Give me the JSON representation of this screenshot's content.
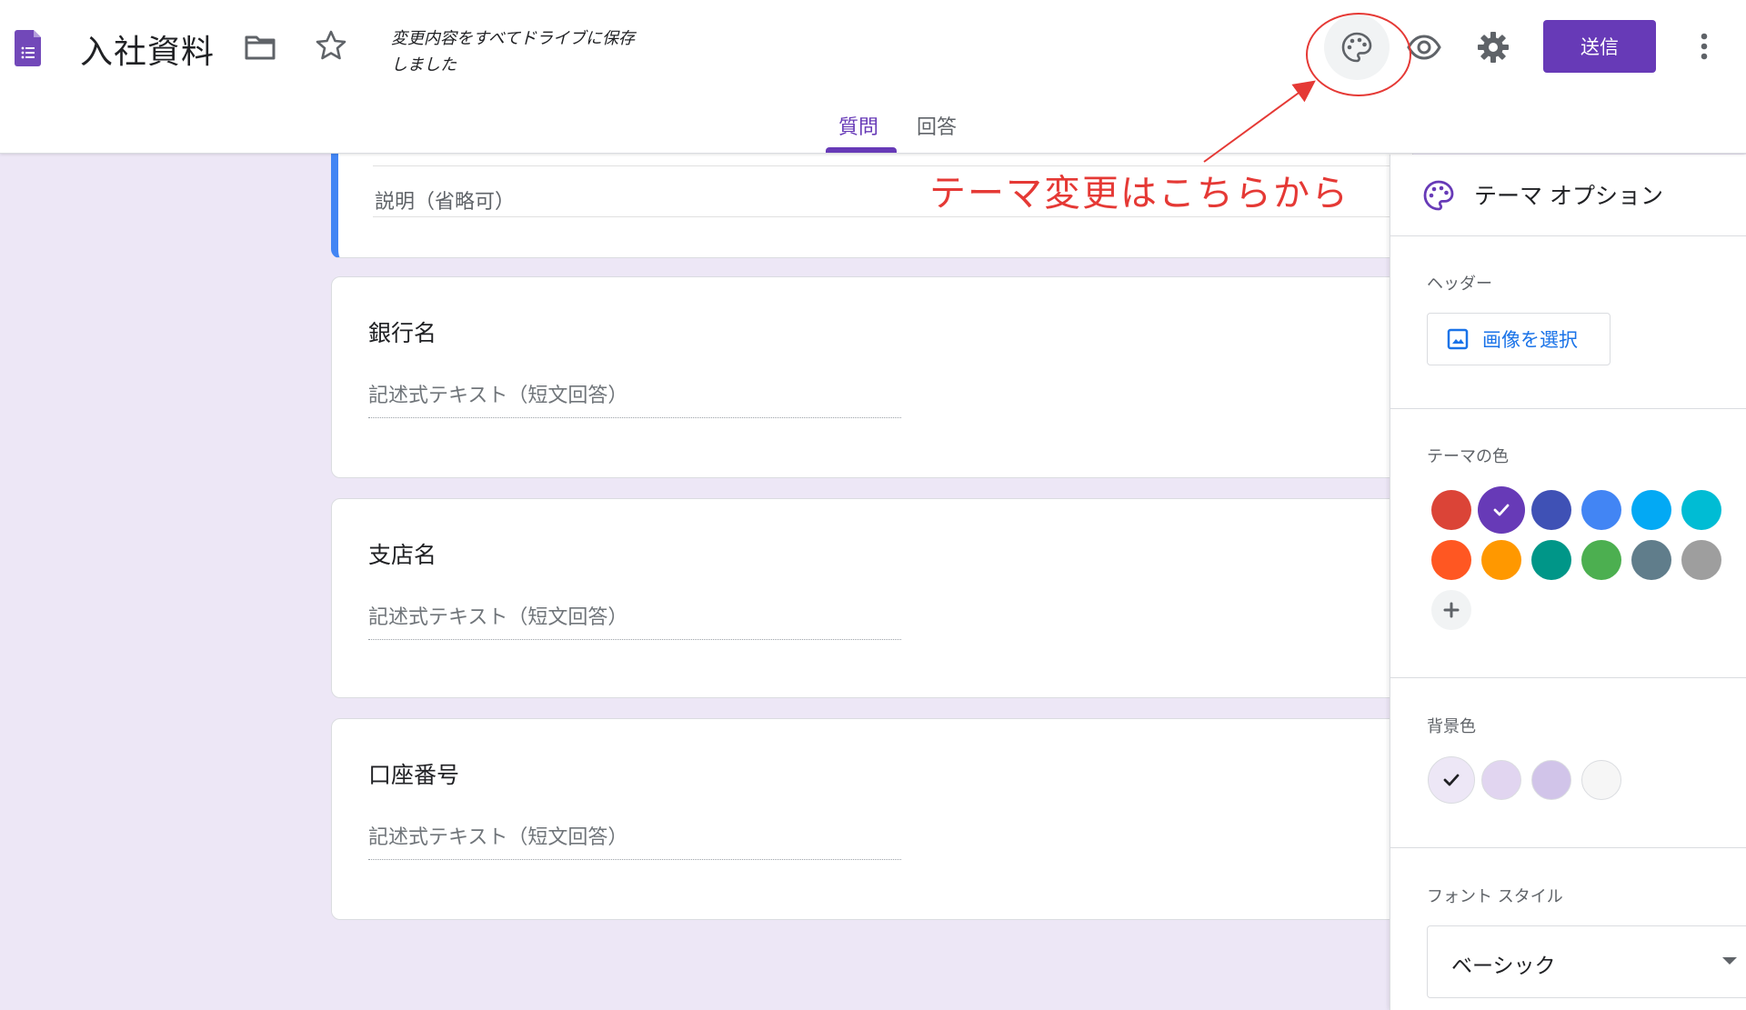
{
  "header": {
    "title": "入社資料",
    "save_status": "変更内容をすべてドライブに保存しました",
    "send_label": "送信",
    "tabs": [
      {
        "label": "質問",
        "active": true
      },
      {
        "label": "回答",
        "active": false
      }
    ],
    "icons": [
      "forms-logo-icon",
      "folder-icon",
      "star-icon",
      "palette-icon",
      "eye-icon",
      "gear-icon",
      "more-vert-icon"
    ],
    "accent_color": "#673ab7"
  },
  "form": {
    "description_placeholder": "説明（省略可）",
    "questions": [
      {
        "title": "銀行名",
        "answer_placeholder": "記述式テキスト（短文回答）"
      },
      {
        "title": "支店名",
        "answer_placeholder": "記述式テキスト（短文回答）"
      },
      {
        "title": "口座番号",
        "answer_placeholder": "記述式テキスト（短文回答）"
      }
    ]
  },
  "annotation": {
    "text": "テーマ変更はこちらから",
    "color": "#e53935"
  },
  "theme_panel": {
    "title": "テーマ オプション",
    "header_label": "ヘッダー",
    "select_image_label": "画像を選択",
    "theme_color_label": "テーマの色",
    "theme_colors": [
      "#db4437",
      "#673ab7",
      "#3f51b5",
      "#4285f4",
      "#03a9f4",
      "#00bcd4",
      "#ff5722",
      "#ff9800",
      "#009688",
      "#4caf50",
      "#607d8b",
      "#9e9e9e"
    ],
    "selected_theme_color": "#673ab7",
    "background_color_label": "背景色",
    "background_colors": [
      "#ede7f6",
      "#e1d5f0",
      "#d1c4e9",
      "#f6f6f6"
    ],
    "selected_background_color": "#ede7f6",
    "font_style_label": "フォント スタイル",
    "font_style_value": "ベーシック"
  }
}
